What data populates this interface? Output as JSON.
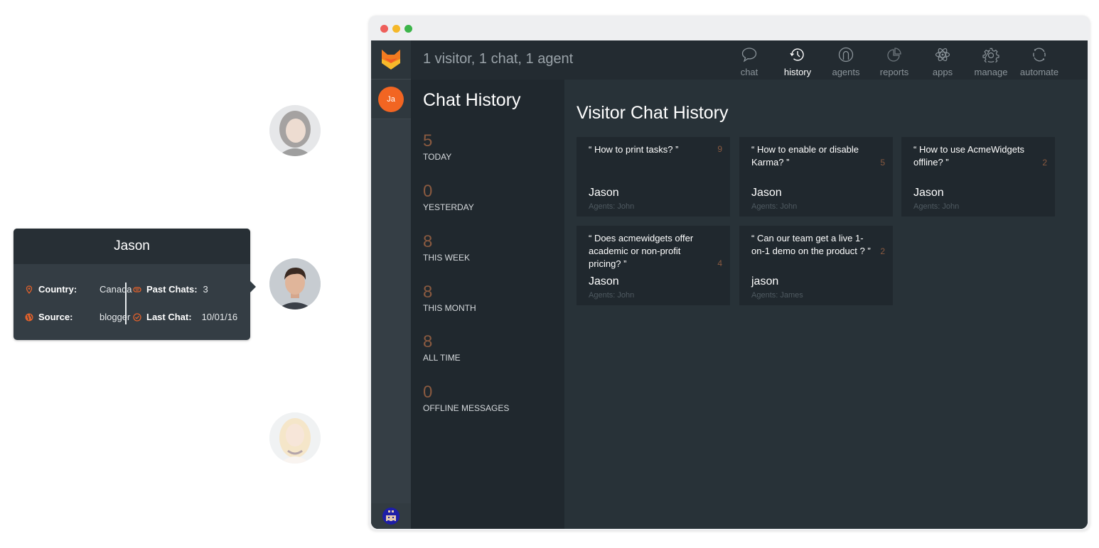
{
  "visitors": [
    {
      "name": "visitor-1",
      "faded": true
    },
    {
      "name": "Jason",
      "faded": false
    },
    {
      "name": "visitor-3",
      "faded": true
    }
  ],
  "visitor_card": {
    "name": "Jason",
    "country_label": "Country:",
    "country": "Canada",
    "source_label": "Source:",
    "source": "blogger",
    "past_chats_label": "Past Chats:",
    "past_chats": "3",
    "last_chat_label": "Last Chat:",
    "last_chat": "10/01/16",
    "icons": {
      "country": "location-pin-icon",
      "source": "globe-icon",
      "past_chats": "chat-bubbles-icon",
      "last_chat": "check-circle-icon"
    }
  },
  "window": {
    "controls": [
      "close",
      "minimize",
      "maximize"
    ]
  },
  "rail": {
    "logo": "fox-logo-icon",
    "current_user_initials": "Ja",
    "agent_avatar": "pixel-agent-avatar"
  },
  "topbar": {
    "summary": "1 visitor, 1 chat, 1 agent",
    "nav": [
      {
        "label": "chat",
        "icon": "chat-bubble-icon",
        "active": false
      },
      {
        "label": "history",
        "icon": "history-clock-icon",
        "active": true
      },
      {
        "label": "agents",
        "icon": "agent-user-icon",
        "active": false
      },
      {
        "label": "reports",
        "icon": "pie-chart-icon",
        "active": false
      },
      {
        "label": "apps",
        "icon": "atom-icon",
        "active": false
      },
      {
        "label": "manage",
        "icon": "gear-icon",
        "active": false
      },
      {
        "label": "automate",
        "icon": "refresh-cycle-icon",
        "active": false
      }
    ]
  },
  "history": {
    "title": "Chat History",
    "stats": [
      {
        "value": "5",
        "label": "TODAY"
      },
      {
        "value": "0",
        "label": "YESTERDAY"
      },
      {
        "value": "8",
        "label": "THIS WEEK"
      },
      {
        "value": "8",
        "label": "THIS MONTH"
      },
      {
        "value": "8",
        "label": "ALL TIME"
      },
      {
        "value": "0",
        "label": "OFFLINE MESSAGES"
      }
    ]
  },
  "main": {
    "title": "Visitor Chat History",
    "cards": [
      {
        "question": "“ How to print tasks? ”",
        "count": "9",
        "visitor": "Jason",
        "agents": "Agents: John"
      },
      {
        "question": "“ How to enable or disable Karma? ”",
        "count": "5",
        "visitor": "Jason",
        "agents": "Agents: John"
      },
      {
        "question": "“ How to use AcmeWidgets offline?  ”",
        "count": "2",
        "visitor": "Jason",
        "agents": "Agents: John"
      },
      {
        "question": "“ Does acmewidgets offer academic or non-profit pricing? ”",
        "count": "4",
        "visitor": "Jason",
        "agents": "Agents: John"
      },
      {
        "question": "“ Can our team get a live 1-on-1 demo on the product ? ”",
        "count": "2",
        "visitor": "jason",
        "agents": "Agents: James"
      }
    ]
  },
  "colors": {
    "accent_orange": "#f26522",
    "count_brown": "#8a5a40",
    "app_bg": "#283238",
    "panel_dark": "#20282e"
  }
}
